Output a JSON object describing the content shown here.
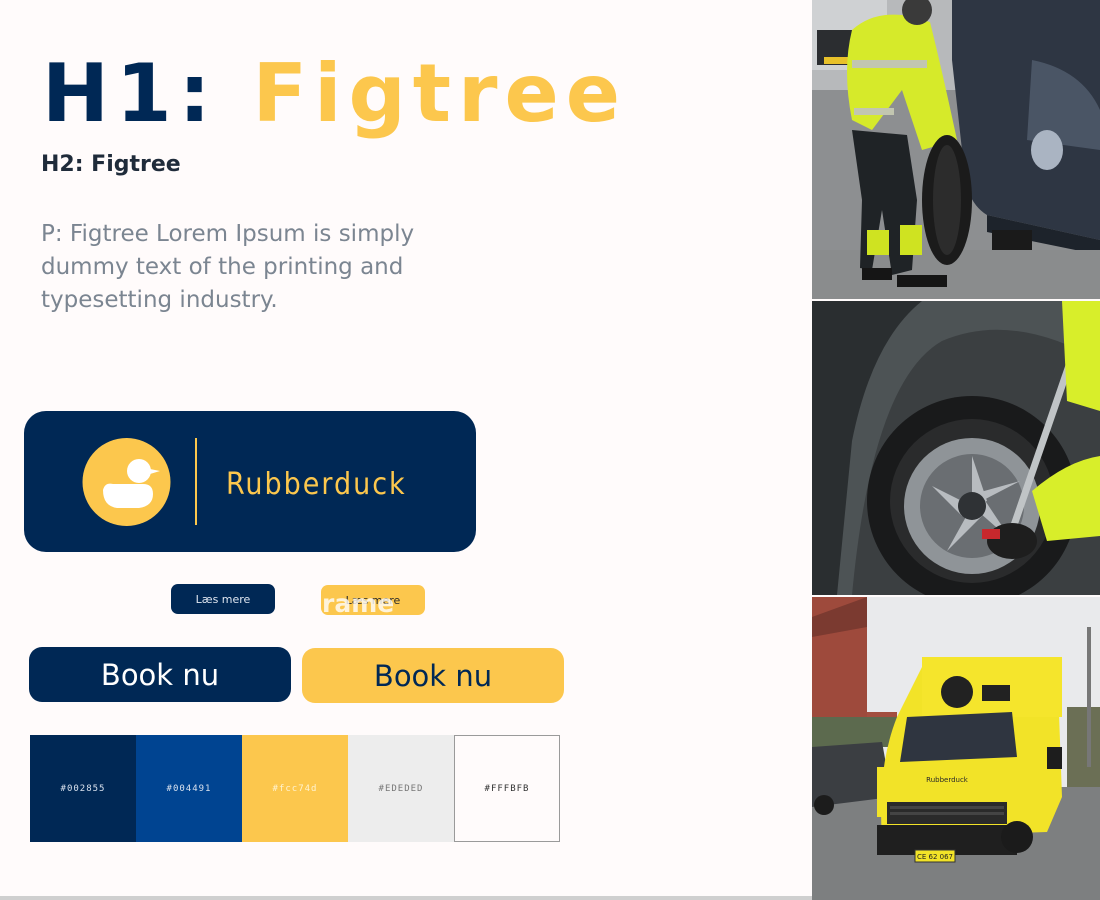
{
  "typography": {
    "h1_prefix": "H1: ",
    "h1_font": "Figtree",
    "h2": "H2: Figtree",
    "paragraph": "P: Figtree Lorem Ipsum is simply dummy text of the printing and typesetting industry."
  },
  "logo": {
    "wordmark": "Rubberduck"
  },
  "buttons": {
    "small_primary": "Læs mere",
    "small_secondary": "Læs mere",
    "large_primary": "Book nu",
    "large_secondary": "Book nu",
    "ghost_text": "rame"
  },
  "palette": [
    {
      "hex": "#002855",
      "label": "#002855"
    },
    {
      "hex": "#004491",
      "label": "#004491"
    },
    {
      "hex": "#fcc74d",
      "label": "#fcc74d"
    },
    {
      "hex": "#EDEDED",
      "label": "#EDEDED"
    },
    {
      "hex": "#FFFBFB",
      "label": "#FFFBFB"
    }
  ],
  "photos": {
    "van_logo_text": "Rubberduck",
    "van_plate": "CE 62 067"
  }
}
